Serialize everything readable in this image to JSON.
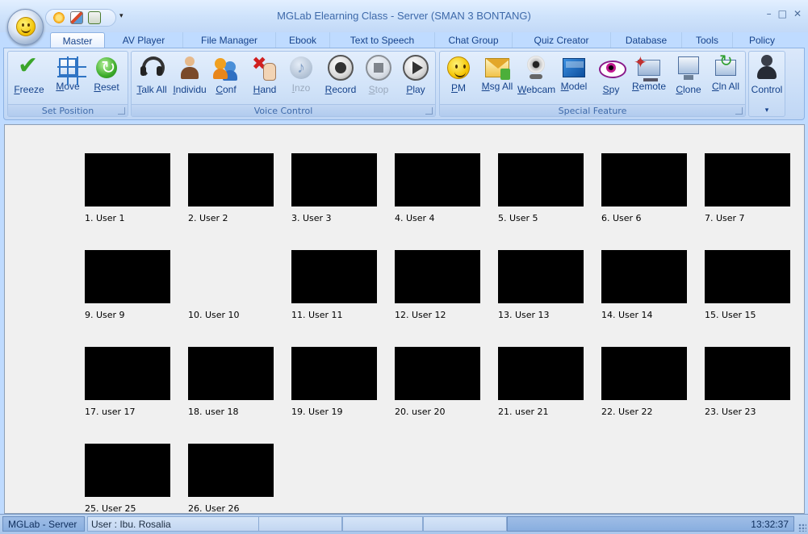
{
  "window": {
    "title": "MGLab  Elearning Class -   Server (SMAN 3 BONTANG)",
    "controls": [
      "–",
      "□",
      "✕"
    ],
    "qat_more": "▾"
  },
  "tabs": [
    {
      "label": "Master",
      "active": true
    },
    {
      "label": "AV Player"
    },
    {
      "label": "File Manager"
    },
    {
      "label": "Ebook"
    },
    {
      "label": "Text to Speech"
    },
    {
      "label": "Chat Group"
    },
    {
      "label": "Quiz Creator"
    },
    {
      "label": "Database"
    },
    {
      "label": "Tools"
    },
    {
      "label": "Policy"
    }
  ],
  "ribbon": {
    "groups": [
      {
        "label": "Set Position",
        "buttons": [
          {
            "key": "F",
            "rest": "reeze",
            "icon": "check-icon"
          },
          {
            "key": "M",
            "rest": "ove",
            "icon": "move-icon"
          },
          {
            "key": "R",
            "rest": "eset",
            "icon": "reset-icon"
          }
        ]
      },
      {
        "label": "Voice Control",
        "buttons": [
          {
            "key": "T",
            "rest": "alk All",
            "icon": "headset-icon"
          },
          {
            "key": "I",
            "rest": "ndividu",
            "icon": "person-icon"
          },
          {
            "key": "C",
            "rest": "onf",
            "icon": "conference-icon"
          },
          {
            "key": "H",
            "rest": "and",
            "icon": "hand-icon"
          },
          {
            "key": "I",
            "rest": "nzo",
            "icon": "music-icon",
            "disabled": true
          },
          {
            "key": "R",
            "rest": "ecord",
            "icon": "record-icon"
          },
          {
            "key": "S",
            "rest": "top",
            "icon": "stop-icon",
            "disabled": true
          },
          {
            "key": "P",
            "rest": "lay",
            "icon": "play-icon"
          }
        ]
      },
      {
        "label": "Special Feature",
        "buttons": [
          {
            "key": "P",
            "rest": "M",
            "icon": "smiley-icon"
          },
          {
            "key": "M",
            "rest": "sg All",
            "icon": "mail-icon"
          },
          {
            "key": "W",
            "rest": "ebcam",
            "icon": "webcam-icon"
          },
          {
            "key": "M",
            "rest": "odel",
            "icon": "monitor-icon"
          },
          {
            "key": "S",
            "rest": "py",
            "icon": "eye-icon"
          },
          {
            "key": "R",
            "rest": "emote",
            "icon": "remote-icon"
          },
          {
            "key": "C",
            "rest": "lone",
            "icon": "clone-icon"
          },
          {
            "key": "C",
            "rest": "ln All",
            "icon": "clone-all-icon"
          }
        ]
      },
      {
        "label": "",
        "buttons": [
          {
            "key": "",
            "rest": "Control",
            "icon": "control-icon"
          }
        ],
        "dropdown": "▾"
      }
    ]
  },
  "clients": [
    {
      "label": "1. User 1",
      "screen": true
    },
    {
      "label": "2. User 2",
      "screen": true
    },
    {
      "label": "3. User 3",
      "screen": true
    },
    {
      "label": "4. User 4",
      "screen": true
    },
    {
      "label": "5. User 5",
      "screen": true
    },
    {
      "label": "6. User 6",
      "screen": true
    },
    {
      "label": "7. User 7",
      "screen": true
    },
    {
      "label": "9. User 9",
      "screen": true
    },
    {
      "label": "10. User 10",
      "screen": false
    },
    {
      "label": "11. User 11",
      "screen": true
    },
    {
      "label": "12. User 12",
      "screen": true
    },
    {
      "label": "13. User 13",
      "screen": true
    },
    {
      "label": "14. User 14",
      "screen": true
    },
    {
      "label": "15. User 15",
      "screen": true
    },
    {
      "label": "17. user 17",
      "screen": true
    },
    {
      "label": "18. user 18",
      "screen": true
    },
    {
      "label": "19. User 19",
      "screen": true
    },
    {
      "label": "20. user 20",
      "screen": true
    },
    {
      "label": "21. user 21",
      "screen": true
    },
    {
      "label": "22. User 22",
      "screen": true
    },
    {
      "label": "23. User 23",
      "screen": true
    },
    {
      "label": "25. User 25",
      "screen": true
    },
    {
      "label": "26. User 26",
      "screen": true
    }
  ],
  "statusbar": {
    "app": "MGLab - Server",
    "user": "User : Ibu. Rosalia",
    "time": "13:32:37"
  }
}
